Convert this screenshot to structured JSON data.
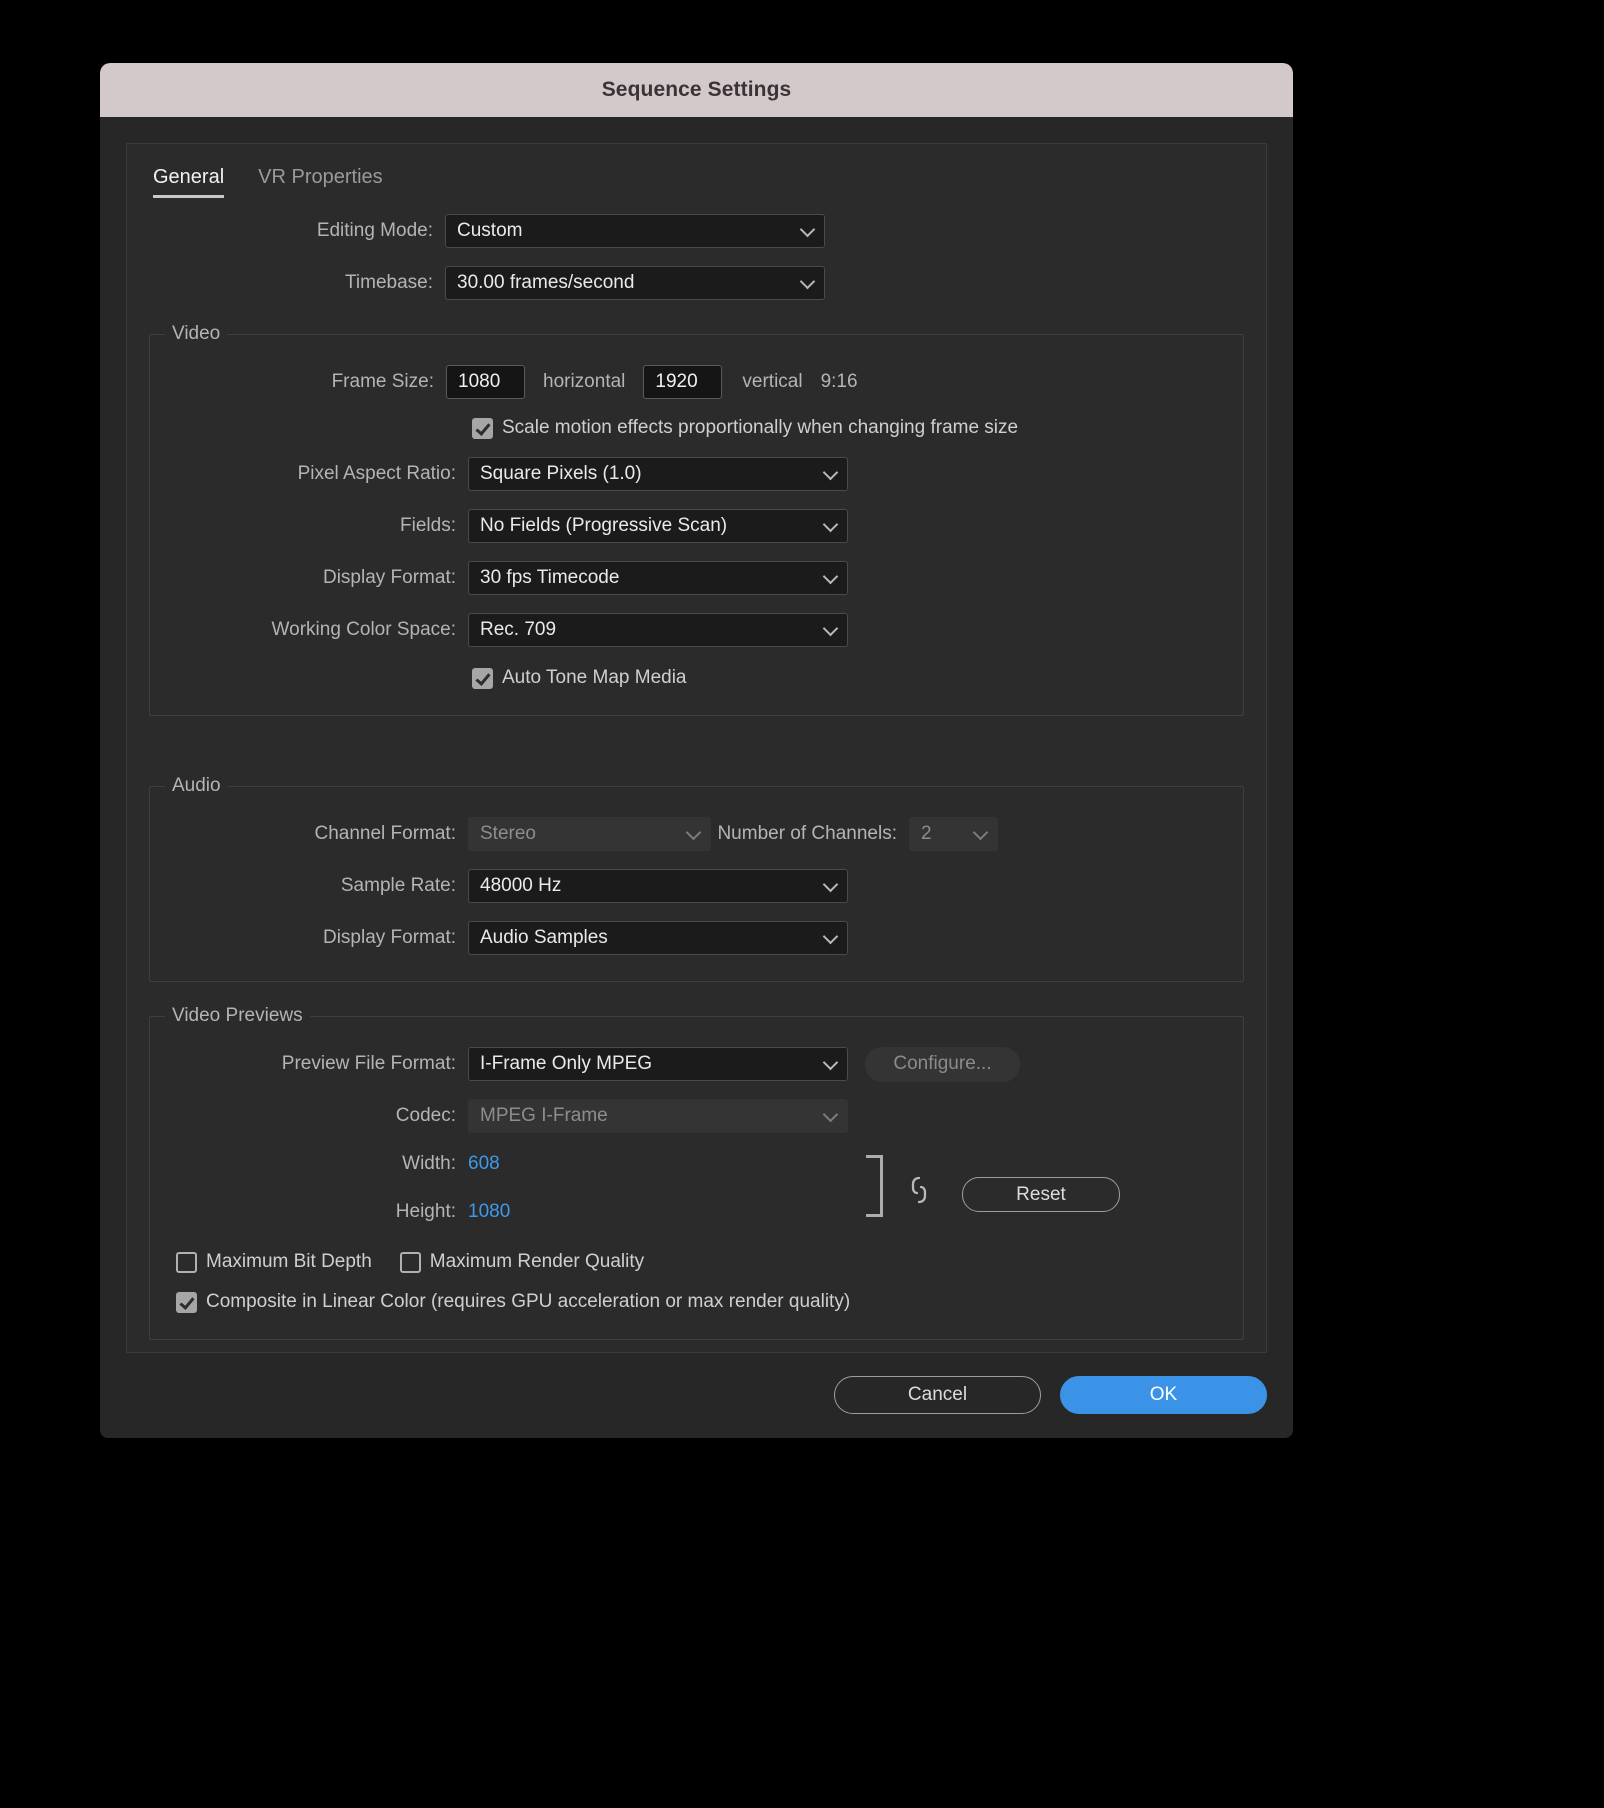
{
  "window": {
    "title": "Sequence Settings"
  },
  "tabs": [
    {
      "label": "General",
      "active": true
    },
    {
      "label": "VR Properties",
      "active": false
    }
  ],
  "top_fields": {
    "editing_mode_label": "Editing Mode:",
    "editing_mode_value": "Custom",
    "timebase_label": "Timebase:",
    "timebase_value": "30.00  frames/second"
  },
  "video": {
    "legend": "Video",
    "frame_size_label": "Frame Size:",
    "frame_width": "1080",
    "horizontal_label": "horizontal",
    "frame_height": "1920",
    "vertical_label": "vertical",
    "aspect_ratio": "9:16",
    "scale_motion_label": "Scale motion effects proportionally when changing frame size",
    "scale_motion_checked": true,
    "pixel_aspect_label": "Pixel Aspect Ratio:",
    "pixel_aspect_value": "Square Pixels (1.0)",
    "fields_label": "Fields:",
    "fields_value": "No Fields (Progressive Scan)",
    "display_format_label": "Display Format:",
    "display_format_value": "30 fps Timecode",
    "working_color_space_label": "Working Color Space:",
    "working_color_space_value": "Rec. 709",
    "auto_tone_map_label": "Auto Tone Map Media",
    "auto_tone_map_checked": true
  },
  "audio": {
    "legend": "Audio",
    "channel_format_label": "Channel Format:",
    "channel_format_value": "Stereo",
    "number_of_channels_label": "Number of Channels:",
    "number_of_channels_value": "2",
    "sample_rate_label": "Sample Rate:",
    "sample_rate_value": "48000 Hz",
    "display_format_label": "Display Format:",
    "display_format_value": "Audio Samples"
  },
  "video_previews": {
    "legend": "Video Previews",
    "preview_file_format_label": "Preview File Format:",
    "preview_file_format_value": "I-Frame Only MPEG",
    "configure_label": "Configure...",
    "codec_label": "Codec:",
    "codec_value": "MPEG I-Frame",
    "width_label": "Width:",
    "width_value": "608",
    "height_label": "Height:",
    "height_value": "1080",
    "reset_label": "Reset",
    "max_bit_depth_label": "Maximum Bit Depth",
    "max_bit_depth_checked": false,
    "max_render_quality_label": "Maximum Render Quality",
    "max_render_quality_checked": false,
    "composite_linear_label": "Composite in Linear Color (requires GPU acceleration or max render quality)",
    "composite_linear_checked": true
  },
  "footer": {
    "cancel_label": "Cancel",
    "ok_label": "OK"
  },
  "colors": {
    "titlebar_bg": "#d3c9cb",
    "dialog_bg": "#272727",
    "accent_blue": "#3b93e8",
    "scrub_value_blue": "#3d9ae8"
  },
  "icons": {
    "chevron_down": "chevron-down-icon",
    "link": "8"
  }
}
